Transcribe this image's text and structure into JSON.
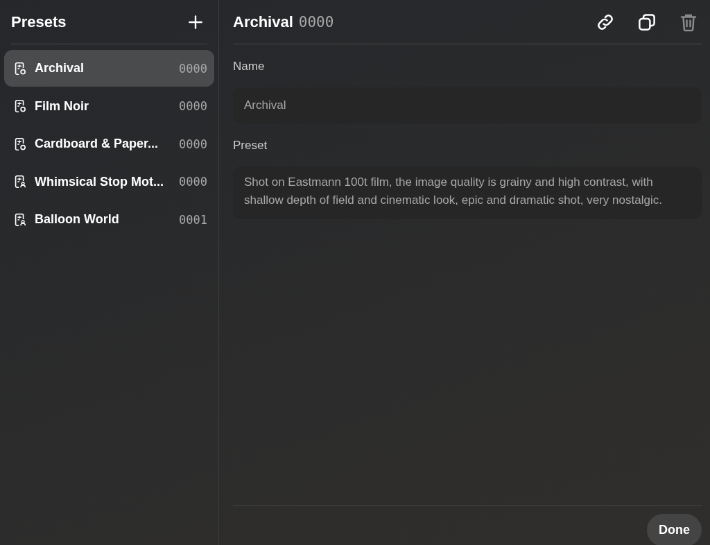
{
  "sidebar": {
    "title": "Presets",
    "items": [
      {
        "name": "Archival",
        "code": "0000",
        "kind": "shape",
        "selected": true
      },
      {
        "name": "Film Noir",
        "code": "0000",
        "kind": "shape",
        "selected": false
      },
      {
        "name": "Cardboard & Paper...",
        "code": "0000",
        "kind": "shape",
        "selected": false
      },
      {
        "name": "Whimsical Stop Mot...",
        "code": "0000",
        "kind": "person",
        "selected": false
      },
      {
        "name": "Balloon World",
        "code": "0001",
        "kind": "person",
        "selected": false
      }
    ]
  },
  "detail": {
    "title": "Archival",
    "code": "0000",
    "actions": [
      {
        "kind": "link",
        "disabled": false
      },
      {
        "kind": "duplicate",
        "disabled": false
      },
      {
        "kind": "delete",
        "disabled": true
      }
    ],
    "fields": [
      {
        "label": "Name",
        "value": "Archival"
      },
      {
        "label": "Preset",
        "value": "Shot on Eastmann 100t film, the image quality is grainy and high contrast, with shallow depth of field and cinematic look, epic and dramatic shot, very nostalgic."
      }
    ],
    "done": "Done"
  }
}
